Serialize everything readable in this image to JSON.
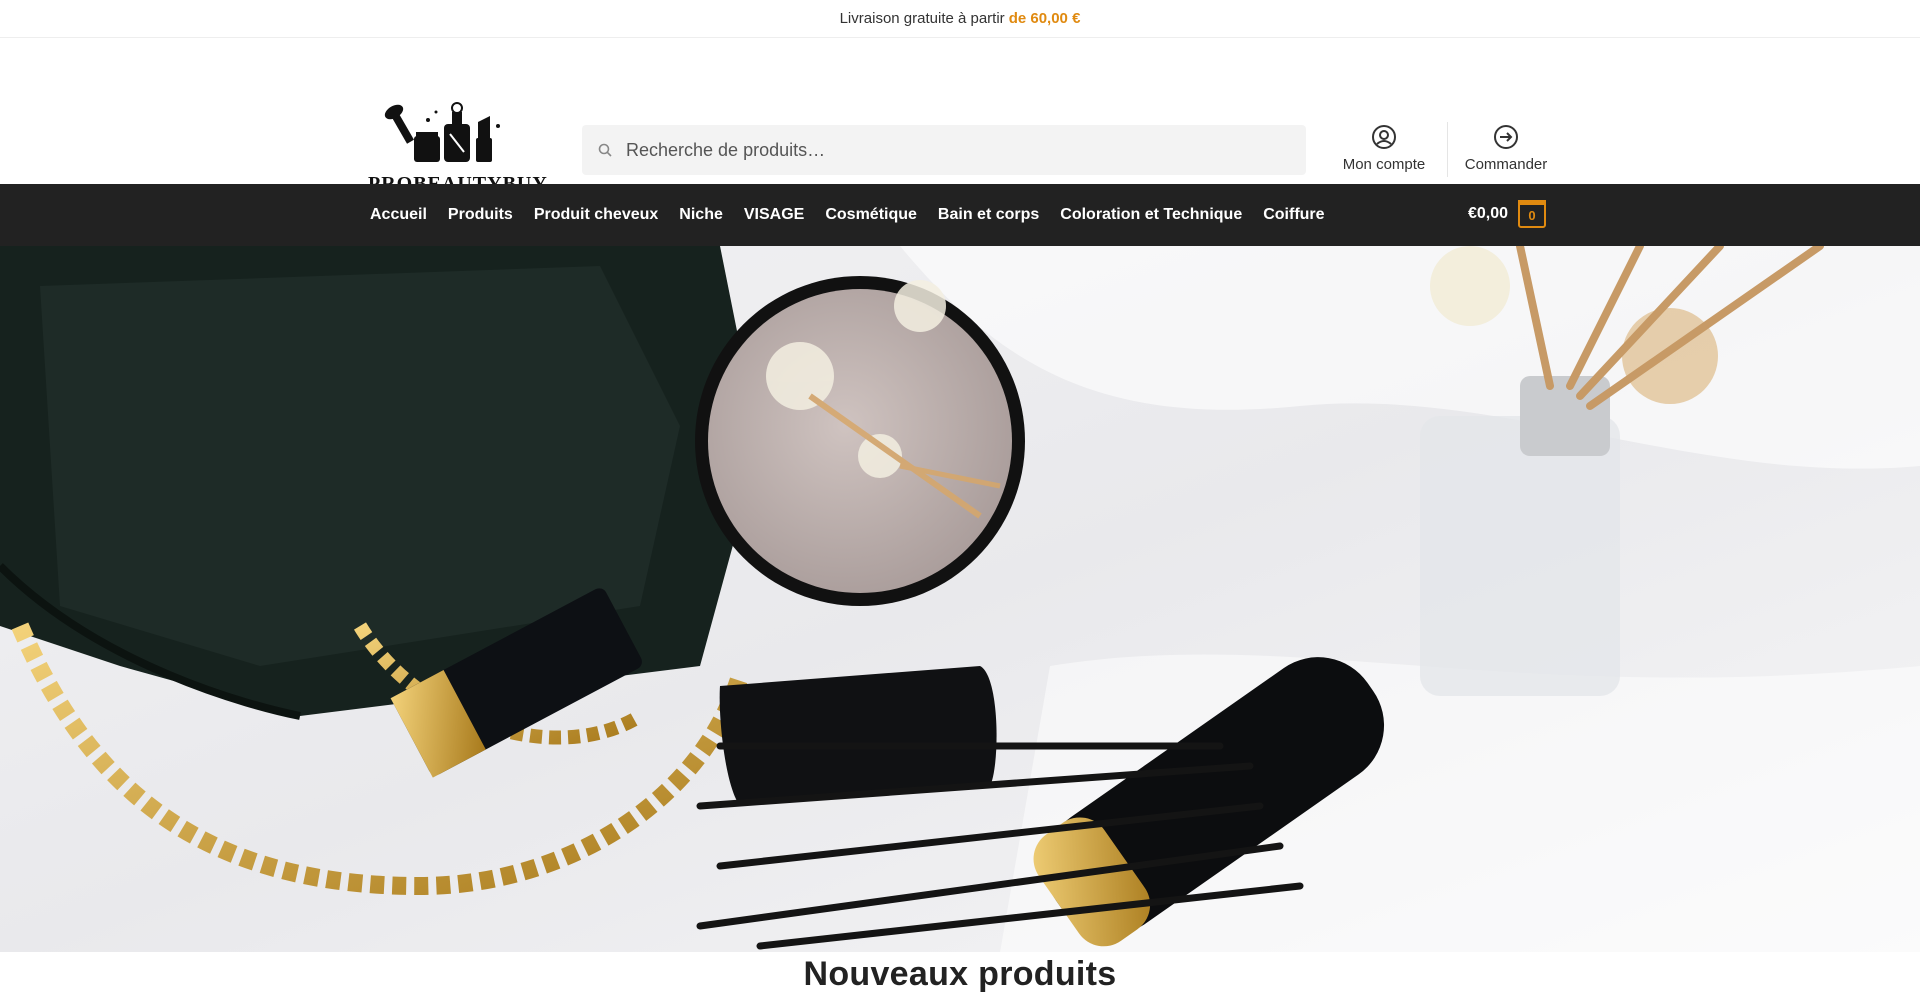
{
  "topbar": {
    "text": "Livraison gratuite à partir",
    "highlight": "de 60,00 €",
    "highlight_color": "#e08a10"
  },
  "header": {
    "logo_text": "PROBEAUTYBUY",
    "search": {
      "placeholder": "Recherche de produits…",
      "icon": "search-icon"
    },
    "account_label": "Mon compte",
    "account_icon": "user-circle-icon",
    "checkout_label": "Commander",
    "checkout_icon": "arrow-right-circle-icon"
  },
  "nav": {
    "items": [
      {
        "label": "Accueil"
      },
      {
        "label": "Produits"
      },
      {
        "label": "Produit cheveux"
      },
      {
        "label": "Niche"
      },
      {
        "label": "VISAGE"
      },
      {
        "label": "Cosmétique"
      },
      {
        "label": "Bain et corps"
      },
      {
        "label": "Coloration et Technique"
      },
      {
        "label": "Coiffure"
      }
    ],
    "cart_total": "€0,00",
    "cart_count": "0",
    "background": "#222222"
  },
  "hero": {
    "alt": "hero-banner-image"
  },
  "section": {
    "title": "Nouveaux produits"
  }
}
